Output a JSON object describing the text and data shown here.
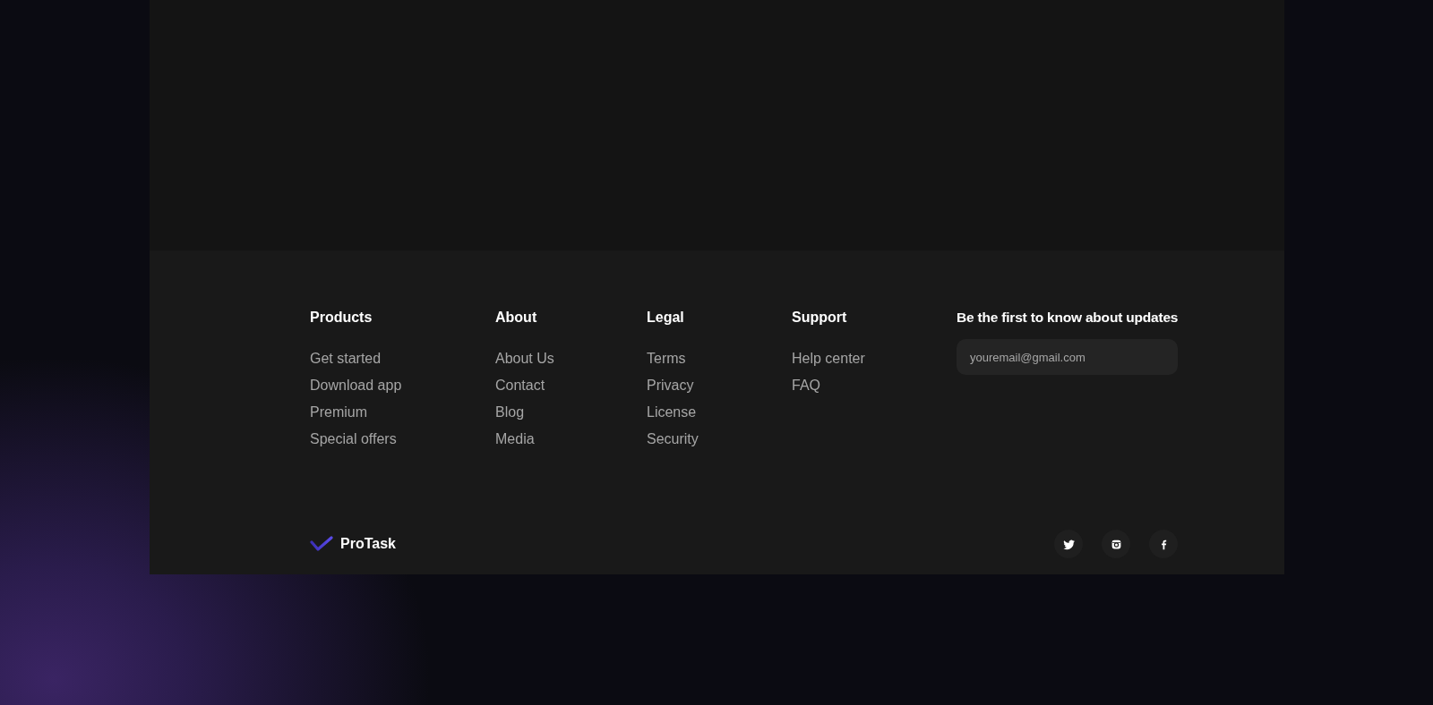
{
  "footer": {
    "columns": [
      {
        "heading": "Products",
        "links": [
          "Get started",
          "Download app",
          "Premium",
          "Special offers"
        ]
      },
      {
        "heading": "About",
        "links": [
          "About Us",
          "Contact",
          "Blog",
          "Media"
        ]
      },
      {
        "heading": "Legal",
        "links": [
          "Terms",
          "Privacy",
          "License",
          "Security"
        ]
      },
      {
        "heading": "Support",
        "links": [
          "Help center",
          "FAQ"
        ]
      }
    ],
    "newsletter": {
      "heading": "Be the first to know about updates",
      "placeholder": "youremail@gmail.com"
    },
    "logo": {
      "name": "ProTask"
    },
    "social": [
      {
        "kind": "twitter"
      },
      {
        "kind": "instagram"
      },
      {
        "kind": "facebook"
      }
    ]
  }
}
